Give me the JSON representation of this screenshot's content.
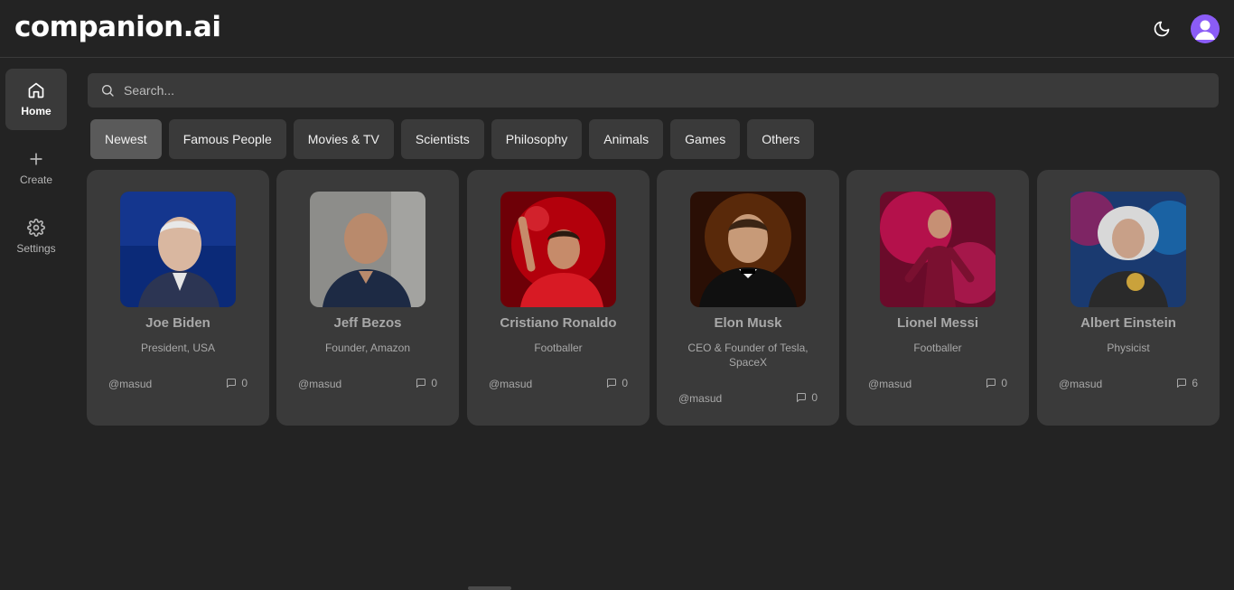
{
  "app": {
    "logo": "companion.ai"
  },
  "header": {
    "theme_icon": "moon-icon",
    "avatar_icon": "user-icon",
    "avatar_color": "#8b5cf6"
  },
  "sidebar": {
    "items": [
      {
        "label": "Home",
        "icon": "home-icon",
        "active": true
      },
      {
        "label": "Create",
        "icon": "plus-icon",
        "active": false
      },
      {
        "label": "Settings",
        "icon": "gear-icon",
        "active": false
      }
    ]
  },
  "search": {
    "placeholder": "Search...",
    "value": ""
  },
  "categories": [
    {
      "label": "Newest",
      "active": true
    },
    {
      "label": "Famous People",
      "active": false
    },
    {
      "label": "Movies & TV",
      "active": false
    },
    {
      "label": "Scientists",
      "active": false
    },
    {
      "label": "Philosophy",
      "active": false
    },
    {
      "label": "Animals",
      "active": false
    },
    {
      "label": "Games",
      "active": false
    },
    {
      "label": "Others",
      "active": false
    }
  ],
  "companions": [
    {
      "name": "Joe Biden",
      "description": "President, USA",
      "handle": "@masud",
      "messages": "0",
      "photo_colors": [
        "#0b2a78",
        "#9aa0b0"
      ]
    },
    {
      "name": "Jeff Bezos",
      "description": "Founder, Amazon",
      "handle": "@masud",
      "messages": "0",
      "photo_colors": [
        "#8d8d8a",
        "#1d2a44"
      ]
    },
    {
      "name": "Cristiano Ronaldo",
      "description": "Footballer",
      "handle": "@masud",
      "messages": "0",
      "photo_colors": [
        "#b3000c",
        "#d81a24"
      ]
    },
    {
      "name": "Elon Musk",
      "description": "CEO & Founder of Tesla, SpaceX",
      "handle": "@masud",
      "messages": "0",
      "photo_colors": [
        "#2a0f05",
        "#101010"
      ]
    },
    {
      "name": "Lionel Messi",
      "description": "Footballer",
      "handle": "@masud",
      "messages": "0",
      "photo_colors": [
        "#d4145a",
        "#6a0b2a"
      ]
    },
    {
      "name": "Albert Einstein",
      "description": "Physicist",
      "handle": "@masud",
      "messages": "6",
      "photo_colors": [
        "#1a6db0",
        "#d8d8d8"
      ]
    }
  ]
}
